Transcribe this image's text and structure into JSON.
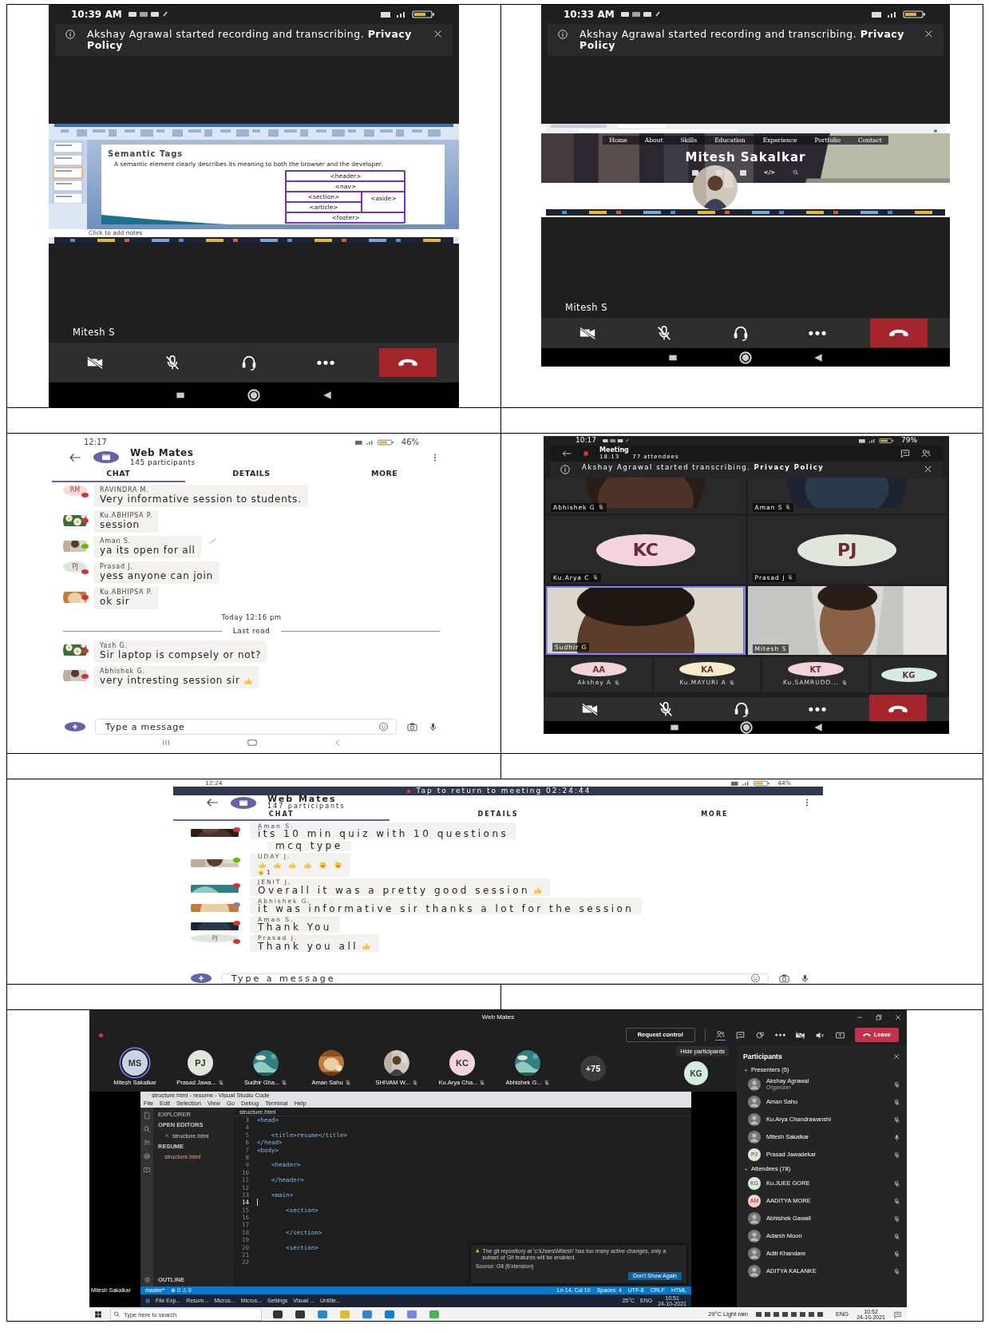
{
  "panels": [
    {
      "kind": "call_screen",
      "status_time": "10:39 AM",
      "banner": "Akshay Agrawal started recording and transcribing. **Privacy Policy**",
      "shared": {
        "kind": "slides",
        "slide_title": "Semantic Tags",
        "bullet": "A semantic element clearly describes its meaning to both the browser and the developer.",
        "diagram": [
          "<header>",
          "<nav>",
          "<section>",
          "<article>",
          "<aside>",
          "<footer>"
        ],
        "notes": "Click to add notes"
      },
      "name": "Mitesh S"
    },
    {
      "kind": "call_screen",
      "status_time": "10:33 AM",
      "banner": "Akshay Agrawal started recording and transcribing. **Privacy Policy**",
      "shared": {
        "kind": "website",
        "nav": [
          "Home",
          "About",
          "Skills",
          "Education",
          "Experience",
          "Portfolio",
          "Contact"
        ],
        "heading": "Mitesh Sakalkar",
        "code_glyph": "</>"
      },
      "name": "Mitesh S"
    },
    {
      "kind": "chat",
      "status_time": "12:17",
      "battery": "46%",
      "title": "Web Mates",
      "subtitle": "145 participants",
      "tabs": [
        {
          "label": "CHAT",
          "selected": true
        },
        {
          "label": "DETAILS",
          "selected": false
        },
        {
          "label": "MORE",
          "selected": false
        }
      ],
      "messages": [
        {
          "kind": "message",
          "avatar": {
            "kind": "initials",
            "initials": "RM",
            "color": "#f6dada"
          },
          "color": "#d13438",
          "sender": "RAVINDRA M.",
          "text": "Very informative session to students.",
          "edited": false,
          "trailing_emoji": false
        },
        {
          "kind": "message",
          "color": "#d13438",
          "sender": "Ku.ABHIPSA P.",
          "text": "session",
          "edited": false,
          "trailing_emoji": false
        },
        {
          "kind": "message",
          "color": "#6bb700",
          "sender": "Aman S.",
          "text": "ya its open for all",
          "edited": true,
          "trailing_emoji": false
        },
        {
          "kind": "message",
          "avatar": {
            "kind": "initials",
            "initials": "PJ",
            "color": "#dde6dc"
          },
          "color": "#d13438",
          "sender": "Prasad J.",
          "text": "yess anyone can join",
          "edited": false,
          "trailing_emoji": false
        },
        {
          "kind": "message",
          "color": "#d13438",
          "sender": "Ku.ABHIPSA P.",
          "text": "ok sir",
          "edited": false,
          "trailing_emoji": false
        },
        {
          "kind": "timestamp",
          "text": "Today 12:16 pm"
        },
        {
          "kind": "divider",
          "text": "Last read"
        },
        {
          "kind": "message",
          "color": "#d13438",
          "sender": "Yash G.",
          "text": "Sir laptop is compsely or not?",
          "edited": false,
          "trailing_emoji": false
        },
        {
          "kind": "message",
          "color": "#d13438",
          "sender": "Abhishek G.",
          "text": "very intresting session sir",
          "edited": false,
          "trailing_emoji": true
        }
      ],
      "input_placeholder": "Type a message"
    },
    {
      "kind": "meeting_grid",
      "status_time": "10:17",
      "battery": "79%",
      "title": "Meeting",
      "timer": "18:13",
      "attendees": "77 attendees",
      "banner": "Akshay Agrawal started transcribing. **Privacy Policy**",
      "tiles": [
        {
          "kind": "picture",
          "name": "Abhishek G",
          "muted": true,
          "selected": false
        },
        {
          "kind": "picture",
          "name": "Aman S",
          "muted": true,
          "selected": false
        },
        {
          "kind": "initials",
          "initials": "KC",
          "color": "#f3d3de",
          "name": "Ku.Arya C",
          "muted": true,
          "selected": false
        },
        {
          "kind": "initials",
          "initials": "PJ",
          "color": "#dfe6dc",
          "name": "Prasad J",
          "muted": true,
          "selected": false
        },
        {
          "kind": "video",
          "name": "Sudhir G",
          "muted": false,
          "selected": true
        },
        {
          "kind": "video",
          "name": "Mitesh S",
          "muted": false,
          "selected": false
        }
      ],
      "small_tiles": [
        {
          "initials": "AA",
          "color": "#f1d4d8",
          "name": "Akshay A",
          "muted": true
        },
        {
          "initials": "KA",
          "color": "#f6ecc9",
          "name": "Ku.MAYURI A",
          "muted": true
        },
        {
          "initials": "KT",
          "color": "#f1d4d8",
          "name": "Ku.SAMRUDD...",
          "muted": true
        },
        {
          "initials": "KG",
          "color": "#d5ede0"
        }
      ]
    },
    {
      "kind": "chat",
      "status_time": "12:24",
      "battery": "44%",
      "banner": "Tap to return to meeting 02:24:44",
      "title": "Web Mates",
      "subtitle": "147 participants",
      "tabs": [
        {
          "label": "CHAT",
          "selected": true
        },
        {
          "label": "DETAILS",
          "selected": false
        },
        {
          "label": "MORE",
          "selected": false
        }
      ],
      "messages": [
        {
          "kind": "message",
          "color": "#d13438",
          "sender": "Aman S.",
          "text": "its 10 min quiz with 10 questions",
          "edited": false,
          "trailing_emoji": false
        },
        {
          "kind": "continuation",
          "text": "mcq type"
        },
        {
          "kind": "emoji_message",
          "color": "#6bb700",
          "sender": "UDAY J.",
          "reaction": "1"
        },
        {
          "kind": "message",
          "color": "#d13438",
          "sender": "JENIT J.",
          "text": "Overall it was a pretty good session",
          "edited": false,
          "trailing_emoji": true
        },
        {
          "kind": "message",
          "color": "#8a8886",
          "sender": "Abhishek G.",
          "text": "it was informative sir thanks a lot for the session",
          "edited": false,
          "trailing_emoji": false
        },
        {
          "kind": "message",
          "color": "#d13438",
          "sender": "Aman S.",
          "text": "Thank You",
          "edited": false,
          "trailing_emoji": false
        },
        {
          "kind": "message",
          "avatar": {
            "kind": "initials",
            "initials": "PJ",
            "color": "#dde6dc"
          },
          "color": "#d13438",
          "sender": "Prasad J.",
          "text": "Thank you all",
          "edited": false,
          "trailing_emoji": true
        }
      ],
      "input_placeholder": "Type a message"
    },
    {
      "kind": "desktop_meeting",
      "title": "Web Mates",
      "request_control": "Request control",
      "leave": "Leave",
      "tooltip": "Hide participants",
      "strip": [
        {
          "kind": "initials",
          "initials": "MS",
          "color": "#c9d3e3",
          "name": "Mitesh Sakalkar",
          "muted": false,
          "selected": true
        },
        {
          "kind": "initials",
          "initials": "PJ",
          "color": "#dfe6dc",
          "name": "Prasad Jawa...",
          "muted": true,
          "selected": false
        },
        {
          "kind": "picture",
          "name": "Sudhir Gha...",
          "muted": true,
          "selected": false
        },
        {
          "kind": "picture",
          "name": "Aman Sahu",
          "muted": true,
          "selected": false
        },
        {
          "kind": "picture",
          "name": "SHIVAM W...",
          "muted": true,
          "selected": false
        },
        {
          "kind": "initials",
          "initials": "KC",
          "color": "#f3d3de",
          "name": "Ku.Arya Cha...",
          "muted": true,
          "selected": false
        },
        {
          "kind": "picture",
          "name": "Abhishek G...",
          "muted": true,
          "selected": false
        },
        {
          "kind": "overflow",
          "initials": "+75",
          "selected": false
        }
      ],
      "side_tile": {
        "initials": "KG",
        "color": "#d5ede0"
      },
      "presenter_label": "Mitesh Sakalkar",
      "editor": {
        "title": "structure.html - resume - Visual Studio Code",
        "menu": [
          "File",
          "Edit",
          "Selection",
          "View",
          "Go",
          "Debug",
          "Terminal",
          "Help"
        ],
        "explorer": "EXPLORER",
        "open_editors": "OPEN EDITORS",
        "open_file": "structure.html",
        "folder": "RESUME",
        "folder_file": "structure.html",
        "outline": "OUTLINE",
        "tab": "structure.html",
        "lines": [
          {
            "no": "3",
            "code": "<head>",
            "current": false
          },
          {
            "no": "4",
            "current": false
          },
          {
            "no": "5",
            "code": "    <title>resume</title>",
            "current": false
          },
          {
            "no": "6",
            "code": "</head>",
            "current": false
          },
          {
            "no": "7",
            "code": "<body>",
            "current": false
          },
          {
            "no": "8",
            "current": false
          },
          {
            "no": "9",
            "code": "    <header>",
            "current": false
          },
          {
            "no": "10",
            "current": false
          },
          {
            "no": "11",
            "code": "    </header>",
            "current": false
          },
          {
            "no": "12",
            "current": false
          },
          {
            "no": "13",
            "code": "    <main>",
            "current": false
          },
          {
            "no": "14",
            "current": true
          },
          {
            "no": "15",
            "code": "        <section>",
            "current": false
          },
          {
            "no": "16",
            "current": false
          },
          {
            "no": "17",
            "current": false
          },
          {
            "no": "18",
            "code": "        </section>",
            "current": false
          },
          {
            "no": "19",
            "current": false
          },
          {
            "no": "20",
            "code": "        <section>",
            "current": false
          },
          {
            "no": "21",
            "current": false
          },
          {
            "no": "22",
            "current": false
          }
        ],
        "notification": {
          "text": "The git repository at 'c:\\Users\\Mitesh' has too many active changes, only a subset of Git features will be enabled.",
          "source": "Source: Git (Extension)",
          "button": "Don't Show Again"
        },
        "status_left": [
          "master*",
          "⊗ 0 ⚠ 0"
        ],
        "status_right": [
          "Ln 14, Col 10",
          "Spaces: 4",
          "UTF-8",
          "CRLF",
          "HTML"
        ]
      },
      "inner_taskbar": {
        "apps": [
          "File Exp...",
          "Resum...",
          "Micros...",
          "Micros...",
          "Settings",
          "Visual ...",
          "Untitle..."
        ],
        "weather": "25°C",
        "lang": "ENG",
        "time": "10:51",
        "date": "24-10-2021"
      },
      "participants": {
        "title": "Participants",
        "groups": [
          {
            "label": "Presenters (5)",
            "expanded": true,
            "people": [
              {
                "avatar": {
                  "kind": "default"
                },
                "name": "Akshay Agrawal",
                "role": "Organizer",
                "mic_on": false
              },
              {
                "avatar": {
                  "kind": "default"
                },
                "name": "Aman Sahu",
                "mic_on": false
              },
              {
                "avatar": {
                  "kind": "default"
                },
                "name": "Ku.Arya Chandrawanshi",
                "mic_on": false
              },
              {
                "avatar": {
                  "kind": "default"
                },
                "name": "Mitesh Sakalkar",
                "mic_on": true
              },
              {
                "avatar": {
                  "kind": "initials",
                  "initials": "PJ",
                  "color": "#dfe6dc"
                },
                "name": "Prasad Jawadekar",
                "mic_on": false
              }
            ]
          },
          {
            "label": "Attendees (78)",
            "expanded": true,
            "people": [
              {
                "avatar": {
                  "kind": "initials",
                  "initials": "KG",
                  "color": "#d5ede0"
                },
                "name": "Ku.JUEE GORE",
                "mic_on": false
              },
              {
                "avatar": {
                  "kind": "initials",
                  "initials": "AM",
                  "color": "#f3cfcf"
                },
                "name": "AADITYA MORE",
                "mic_on": false
              },
              {
                "avatar": {
                  "kind": "default"
                },
                "name": "Abhishek Gawali",
                "mic_on": false
              },
              {
                "avatar": {
                  "kind": "default"
                },
                "name": "Adarsh Moon",
                "mic_on": false
              },
              {
                "avatar": {
                  "kind": "default"
                },
                "name": "Aditi Khandare",
                "mic_on": false
              },
              {
                "avatar": {
                  "kind": "default"
                },
                "name": "ADITYA KALANKE",
                "mic_on": false
              }
            ]
          }
        ]
      },
      "taskbar": {
        "search_placeholder": "Type here to search",
        "weather": "29°C Light rain",
        "lang": "ENG",
        "time": "10:52",
        "date": "24-10-2021"
      }
    }
  ]
}
